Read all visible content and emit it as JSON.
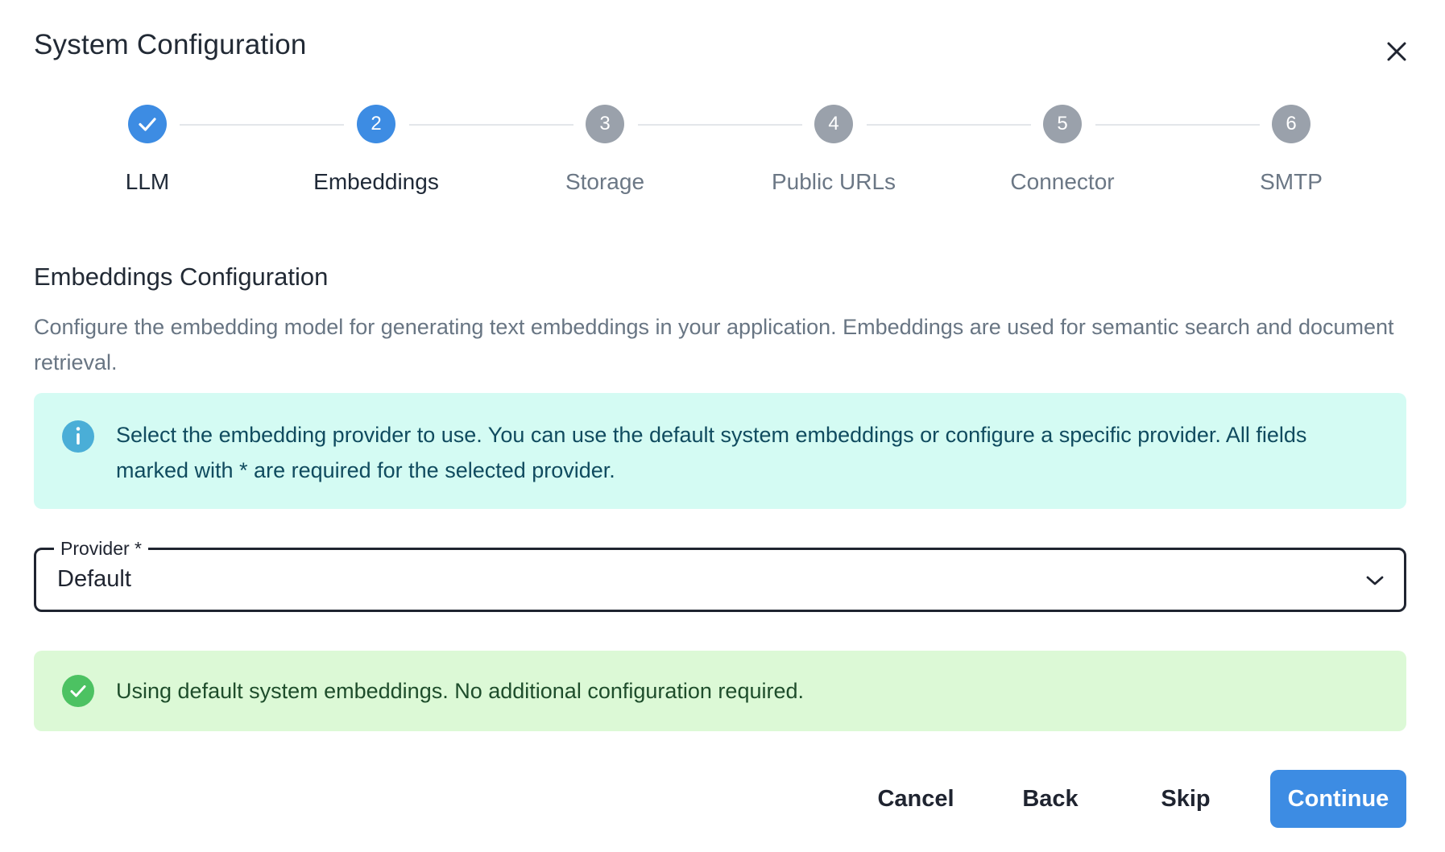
{
  "dialog": {
    "title": "System Configuration",
    "close_icon": "close-icon"
  },
  "stepper": {
    "steps": [
      {
        "number": "1",
        "label": "LLM",
        "state": "completed"
      },
      {
        "number": "2",
        "label": "Embeddings",
        "state": "active"
      },
      {
        "number": "3",
        "label": "Storage",
        "state": "pending"
      },
      {
        "number": "4",
        "label": "Public URLs",
        "state": "pending"
      },
      {
        "number": "5",
        "label": "Connector",
        "state": "pending"
      },
      {
        "number": "6",
        "label": "SMTP",
        "state": "pending"
      }
    ]
  },
  "section": {
    "title": "Embeddings Configuration",
    "description": "Configure the embedding model for generating text embeddings in your application. Embeddings are used for semantic search and document retrieval."
  },
  "info_alert": {
    "icon": "info-icon",
    "text": "Select the embedding provider to use. You can use the default system embeddings or configure a specific provider. All fields marked with * are required for the selected provider."
  },
  "provider_select": {
    "label": "Provider *",
    "value": "Default",
    "icon": "chevron-down-icon"
  },
  "success_alert": {
    "icon": "check-circle-icon",
    "text": "Using default system embeddings. No additional configuration required."
  },
  "footer": {
    "cancel_label": "Cancel",
    "back_label": "Back",
    "skip_label": "Skip",
    "continue_label": "Continue"
  },
  "colors": {
    "primary": "#3d8ce3",
    "step_pending": "#9aa1ab",
    "info_bg": "#d4fbf3",
    "success_bg": "#dcf9d6",
    "success_icon": "#4cc262",
    "info_icon": "#4aaed7"
  }
}
